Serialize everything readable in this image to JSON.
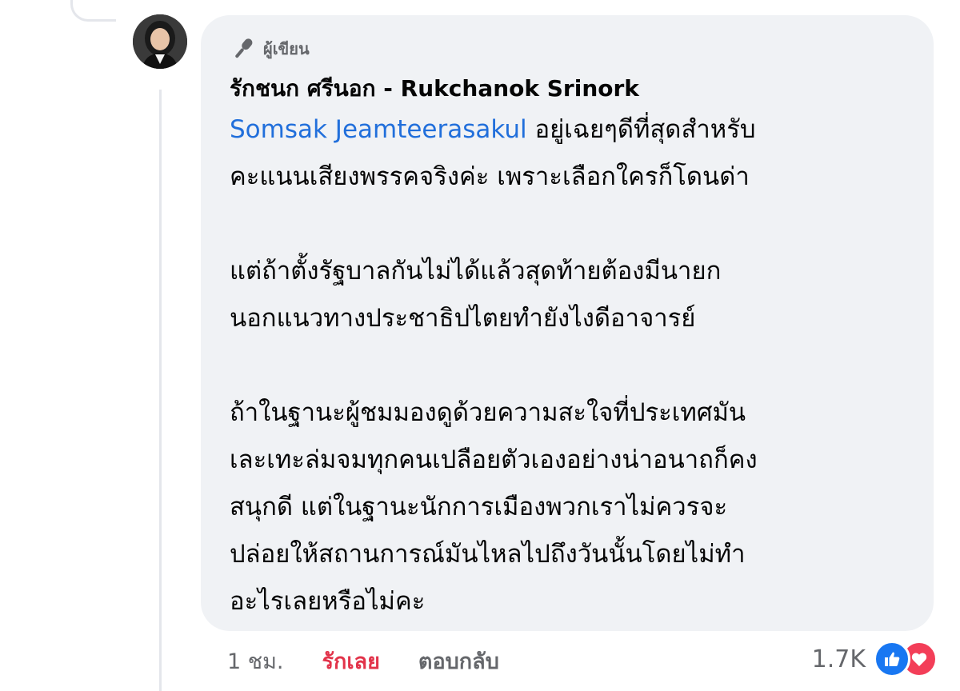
{
  "comment": {
    "badge_label": "ผู้เขียน",
    "author_name": "รักชนก ศรีนอก - Rukchanok Srinork",
    "mention": "Somsak Jeamteerasakul",
    "paragraph1_line1_rest": " อยู่เฉยๆดีที่สุดสำหรับ",
    "paragraph1_line2": "คะแนนเสียงพรรคจริงค่ะ เพราะเลือกใครก็โดนด่า",
    "paragraph2_line1": "แต่ถ้าตั้งรัฐบาลกันไม่ได้แล้วสุดท้ายต้องมีนายก",
    "paragraph2_line2": "นอกแนวทางประชาธิปไตยทำยังไงดีอาจารย์",
    "paragraph3_line1": "ถ้าในฐานะผู้ชมมองดูด้วยความสะใจที่ประเทศมัน",
    "paragraph3_line2": "เละเทะล่มจมทุกคนเปลือยตัวเองอย่างน่าอนาถก็คง",
    "paragraph3_line3": "สนุกดี แต่ในฐานะนักการเมืองพวกเราไม่ควรจะ",
    "paragraph3_line4": "ปล่อยให้สถานการณ์มันไหลไปถึงวันนั้นโดยไม่ทำ",
    "paragraph3_line5": "อะไรเลยหรือไม่คะ"
  },
  "actions": {
    "time": "1 ชม.",
    "love_label": "รักเลย",
    "reply_label": "ตอบกลับ"
  },
  "reactions": {
    "count": "1.7K",
    "icons": [
      "like-icon",
      "heart-icon"
    ]
  },
  "colors": {
    "mention": "#216fdb",
    "love": "#e2334a",
    "bubble": "#f0f2f5"
  }
}
